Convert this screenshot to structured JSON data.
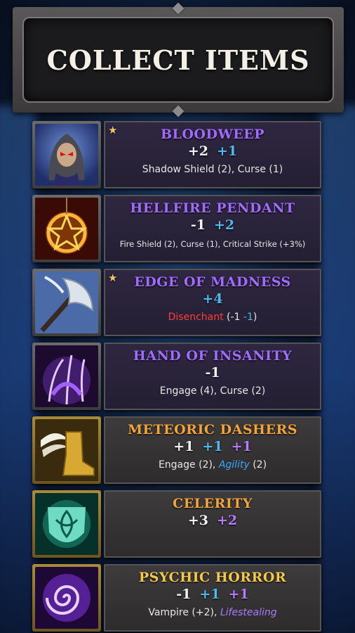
{
  "header": {
    "title": "COLLECT ITEMS"
  },
  "colors": {
    "epic_name": "#a06cff",
    "legendary_name": "#f2a53c",
    "stat_white": "#f2f2f2",
    "stat_blue": "#4fb9ee",
    "stat_violet": "#b47cff",
    "negative_red": "#ff3d3d"
  },
  "items": [
    {
      "name": "BLOODWEEP",
      "icon": "hooded-villain-icon",
      "starred": true,
      "stats": [
        {
          "text": "+2",
          "color": "white"
        },
        {
          "text": "+1",
          "color": "blue"
        }
      ],
      "desc": "Shadow Shield (2), Curse (1)"
    },
    {
      "name": "HELLFIRE PENDANT",
      "icon": "pentagram-pendant-icon",
      "starred": false,
      "stats": [
        {
          "text": "-1",
          "color": "white"
        },
        {
          "text": "+2",
          "color": "blue"
        }
      ],
      "desc": "Fire Shield (2), Curse (1), Critical Strike (+3%)"
    },
    {
      "name": "EDGE OF MADNESS",
      "icon": "axe-blade-icon",
      "starred": true,
      "stats": [
        {
          "text": "+4",
          "color": "blue"
        }
      ],
      "desc_parts": {
        "red": "Disenchant",
        "mid": " (-1  ",
        "blue": "-1",
        "end": ")"
      }
    },
    {
      "name": "HAND OF INSANITY",
      "icon": "shadow-hand-icon",
      "starred": false,
      "stats": [
        {
          "text": "-1",
          "color": "white"
        }
      ],
      "desc": "Engage (4), Curse (2)"
    },
    {
      "name": "METEORIC DASHERS",
      "icon": "winged-boot-icon",
      "starred": false,
      "stats": [
        {
          "text": "+1",
          "color": "white"
        },
        {
          "text": "+1",
          "color": "blue"
        },
        {
          "text": "+1",
          "color": "violet"
        }
      ],
      "desc_parts": {
        "lead": "Engage (2), ",
        "italic": "Agility",
        "end": " (2)"
      }
    },
    {
      "name": "CELERITY",
      "icon": "knot-shield-icon",
      "starred": false,
      "stats": [
        {
          "text": "+3",
          "color": "white"
        },
        {
          "text": "+2",
          "color": "violet"
        }
      ],
      "desc": ""
    },
    {
      "name": "PSYCHIC HORROR",
      "icon": "swirl-vortex-icon",
      "starred": false,
      "stats": [
        {
          "text": "-1",
          "color": "white"
        },
        {
          "text": "+1",
          "color": "blue"
        },
        {
          "text": "+1",
          "color": "violet"
        }
      ],
      "desc_parts": {
        "lead": "Vampire (+2), ",
        "italic": "Lifestealing"
      }
    }
  ]
}
